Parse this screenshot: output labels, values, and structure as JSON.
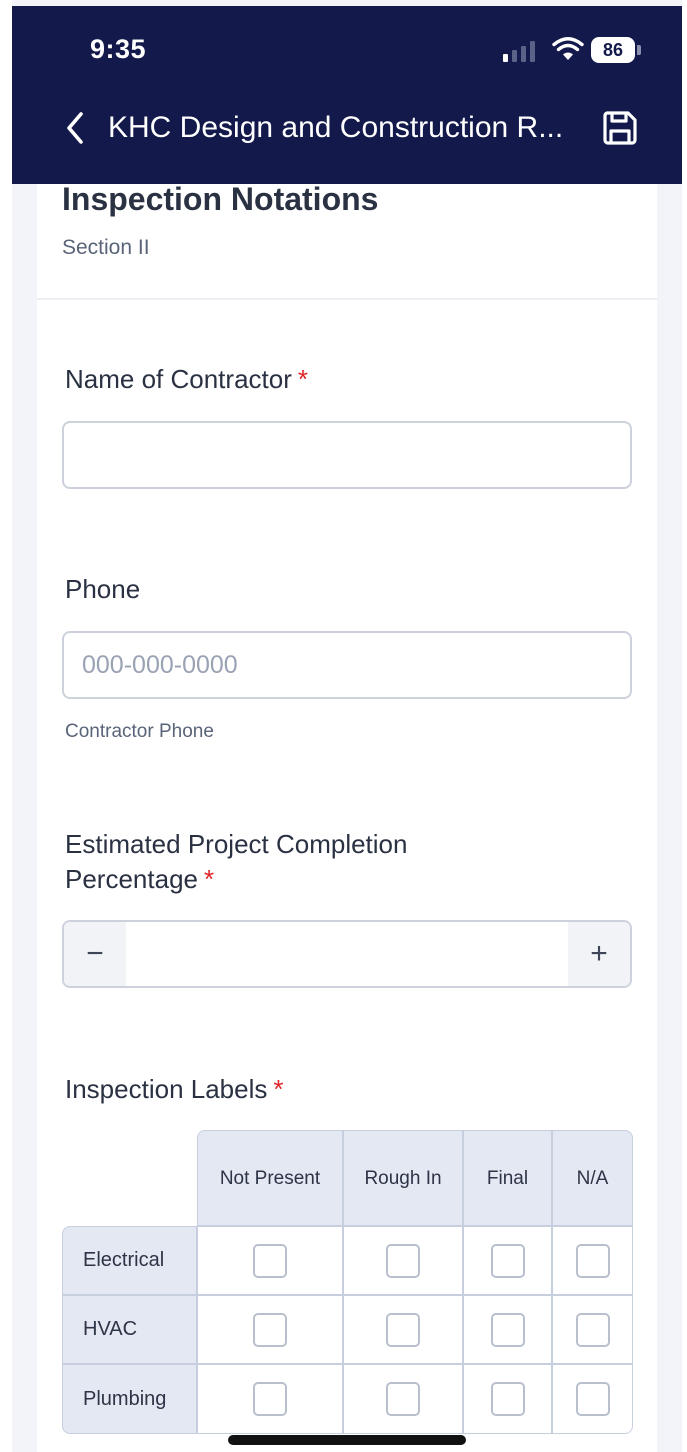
{
  "status_bar": {
    "time": "9:35",
    "battery": "86",
    "icons": [
      "signal-icon",
      "wifi-icon",
      "battery-icon"
    ]
  },
  "nav": {
    "back_icon": "chevron-left-icon",
    "title": "KHC Design and Construction R...",
    "save_icon": "floppy-disk-icon"
  },
  "section": {
    "title": "Inspection Notations",
    "subtitle": "Section II"
  },
  "fields": {
    "contractor": {
      "label": "Name of Contractor",
      "required_mark": "*",
      "value": "",
      "placeholder": ""
    },
    "phone": {
      "label": "Phone",
      "value": "",
      "placeholder": "000-000-0000",
      "helper": "Contractor Phone"
    },
    "completion": {
      "label_line1": "Estimated Project Completion",
      "label_line2": "Percentage",
      "required_mark": "*",
      "value": "",
      "minus": "−",
      "plus": "+"
    },
    "inspection_labels": {
      "label": "Inspection Labels",
      "required_mark": "*",
      "columns": [
        "Not Present",
        "Rough In",
        "Final",
        "N/A"
      ],
      "rows": [
        "Electrical",
        "HVAC",
        "Plumbing"
      ]
    }
  },
  "colors": {
    "header_bg": "#13194b",
    "required": "#e02424",
    "grid_header": "#e3e8f3"
  }
}
